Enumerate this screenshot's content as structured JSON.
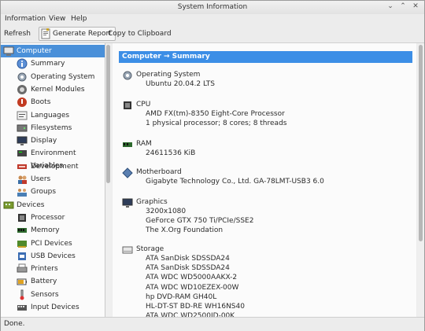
{
  "window": {
    "title": "System Information"
  },
  "menu": {
    "items": [
      "Information",
      "View",
      "Help"
    ]
  },
  "toolbar": {
    "refresh": "Refresh",
    "generate_report": "Generate Report",
    "copy": "Copy to Clipboard"
  },
  "sidebar": {
    "items": [
      {
        "label": "Computer",
        "icon": "computer-icon",
        "level": 0,
        "selected": true
      },
      {
        "label": "Summary",
        "icon": "summary-icon",
        "level": 1
      },
      {
        "label": "Operating System",
        "icon": "os-icon",
        "level": 1
      },
      {
        "label": "Kernel Modules",
        "icon": "kernel-icon",
        "level": 1
      },
      {
        "label": "Boots",
        "icon": "boots-icon",
        "level": 1
      },
      {
        "label": "Languages",
        "icon": "languages-icon",
        "level": 1
      },
      {
        "label": "Filesystems",
        "icon": "filesystems-icon",
        "level": 1
      },
      {
        "label": "Display",
        "icon": "display-icon",
        "level": 1
      },
      {
        "label": "Environment Variables",
        "icon": "env-icon",
        "level": 1
      },
      {
        "label": "Development",
        "icon": "development-icon",
        "level": 1
      },
      {
        "label": "Users",
        "icon": "users-icon",
        "level": 1
      },
      {
        "label": "Groups",
        "icon": "groups-icon",
        "level": 1
      },
      {
        "label": "Devices",
        "icon": "devices-icon",
        "level": 0
      },
      {
        "label": "Processor",
        "icon": "processor-icon",
        "level": 1
      },
      {
        "label": "Memory",
        "icon": "memory-icon",
        "level": 1
      },
      {
        "label": "PCI Devices",
        "icon": "pci-icon",
        "level": 1
      },
      {
        "label": "USB Devices",
        "icon": "usb-icon",
        "level": 1
      },
      {
        "label": "Printers",
        "icon": "printer-icon",
        "level": 1
      },
      {
        "label": "Battery",
        "icon": "battery-icon",
        "level": 1
      },
      {
        "label": "Sensors",
        "icon": "sensors-icon",
        "level": 1
      },
      {
        "label": "Input Devices",
        "icon": "input-icon",
        "level": 1
      }
    ]
  },
  "content": {
    "header": "Computer → Summary",
    "sections": [
      {
        "title": "Operating System",
        "icon": "os-icon",
        "values": [
          "Ubuntu 20.04.2 LTS"
        ]
      },
      {
        "title": "CPU",
        "icon": "cpu-icon",
        "values": [
          "AMD FX(tm)-8350 Eight-Core Processor",
          "1 physical processor; 8 cores; 8 threads"
        ]
      },
      {
        "title": "RAM",
        "icon": "ram-icon",
        "values": [
          "24611536 KiB"
        ]
      },
      {
        "title": "Motherboard",
        "icon": "motherboard-icon",
        "values": [
          "Gigabyte Technology Co., Ltd. GA-78LMT-USB3 6.0"
        ]
      },
      {
        "title": "Graphics",
        "icon": "graphics-icon",
        "values": [
          "3200x1080",
          "GeForce GTX 750 Ti/PCIe/SSE2",
          "The X.Org Foundation"
        ]
      },
      {
        "title": "Storage",
        "icon": "storage-icon",
        "values": [
          "ATA SanDisk SDSSDA24",
          "ATA SanDisk SDSSDA24",
          "ATA WDC WD5000AAKX-2",
          "ATA WDC WD10EZEX-00W",
          "hp DVD-RAM GH40L",
          "HL-DT-ST BD-RE  WH16NS40",
          "ATA WDC WD2500JD-00K"
        ]
      }
    ]
  },
  "status": "Done."
}
